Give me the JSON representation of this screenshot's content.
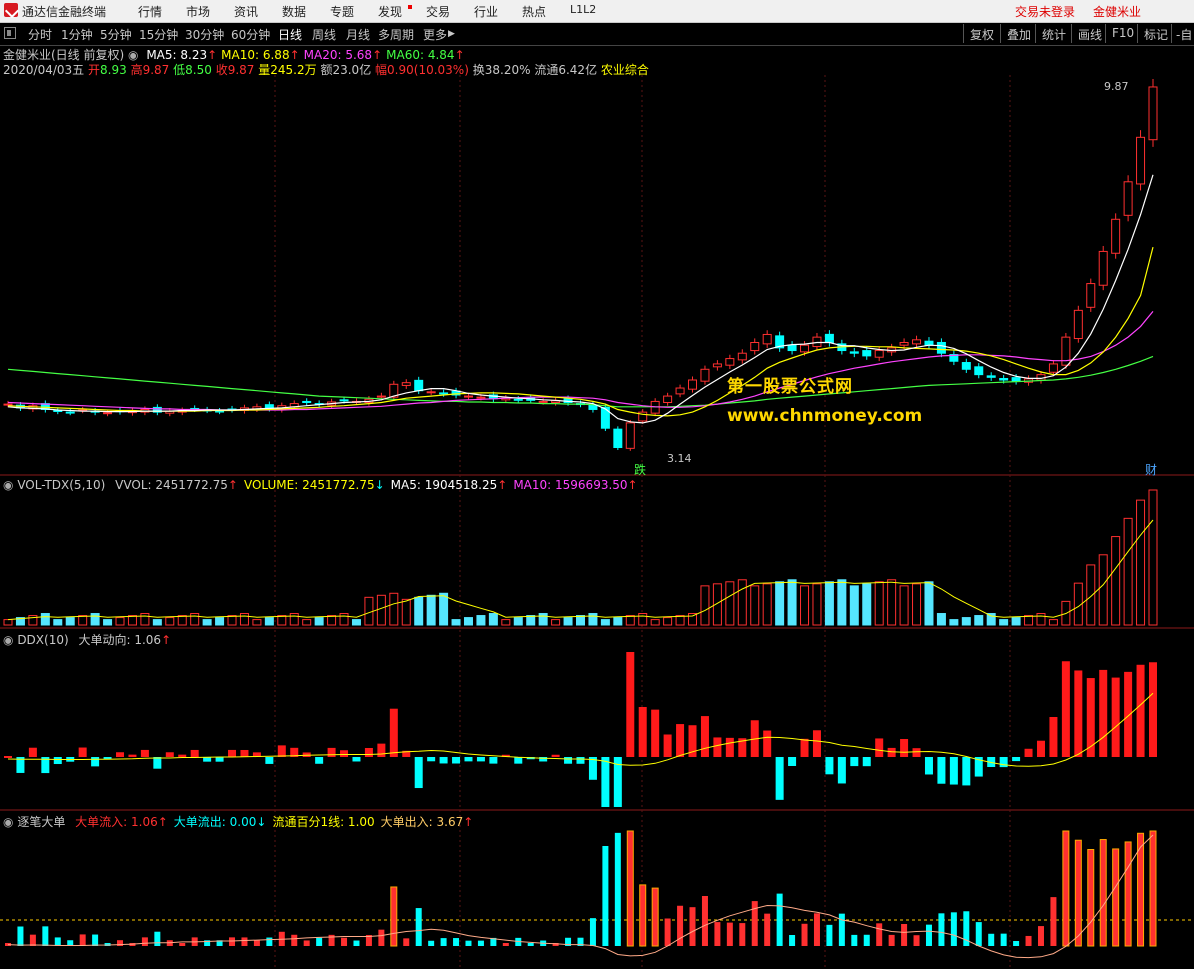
{
  "app": {
    "name": "通达信金融终端"
  },
  "menu": [
    "行情",
    "市场",
    "资讯",
    "数据",
    "专题",
    "发现",
    "交易",
    "行业",
    "热点",
    "L1L2"
  ],
  "menu_right": {
    "status": "交易未登录",
    "stock": "金健米业"
  },
  "periods": [
    "分时",
    "1分钟",
    "5分钟",
    "15分钟",
    "30分钟",
    "60分钟",
    "日线",
    "周线",
    "月线",
    "多周期",
    "更多"
  ],
  "active_period": "日线",
  "toolbar": [
    "复权",
    "叠加",
    "统计",
    "画线",
    "F10",
    "标记",
    "-自"
  ],
  "main_panel": {
    "title": "金健米业(日线 前复权)",
    "ma": [
      {
        "label": "MA5: 8.23",
        "color": "#ffffff"
      },
      {
        "label": "MA10: 6.88",
        "color": "#ffff00"
      },
      {
        "label": "MA20: 5.68",
        "color": "#ff44ff"
      },
      {
        "label": "MA60: 4.84",
        "color": "#44ff44"
      }
    ],
    "quote": {
      "date": "2020/04/03五",
      "open_label": "开",
      "open": "8.93",
      "high_label": "高",
      "high": "9.87",
      "low_label": "低",
      "low": "8.50",
      "close_label": "收",
      "close": "9.87",
      "vol_label": "量",
      "vol": "245.2万",
      "amount_label": "额",
      "amount": "23.0亿",
      "pct_label": "幅",
      "pct": "0.90(10.03%)",
      "turn_label": "换",
      "turn": "38.20%",
      "float_label": "流通",
      "float": "6.42亿",
      "sector": "农业综合"
    },
    "high_mark": "9.87",
    "low_mark": "3.14",
    "mark_die": "跌",
    "mark_cai": "财"
  },
  "watermark": {
    "line1": "第一股票公式网",
    "line2": "www.chnmoney.com"
  },
  "vol_panel": {
    "name": "VOL-TDX(5,10)",
    "items": [
      {
        "label": "VVOL: 2451772.75",
        "color": "#c8c8c8",
        "arrow": "↑",
        "arrow_color": "#ff3030"
      },
      {
        "label": "VOLUME: 2451772.75",
        "color": "#ffff00",
        "arrow": "↓",
        "arrow_color": "#00ffff"
      },
      {
        "label": "MA5: 1904518.25",
        "color": "#ffffff",
        "arrow": "↑",
        "arrow_color": "#ff3030"
      },
      {
        "label": "MA10: 1596693.50",
        "color": "#ff44ff",
        "arrow": "↑",
        "arrow_color": "#ff3030"
      }
    ]
  },
  "ddx_panel": {
    "name": "DDX(10)",
    "items": [
      {
        "label": "大单动向: 1.06",
        "color": "#c8c8c8",
        "arrow": "↑",
        "arrow_color": "#ff3030"
      }
    ]
  },
  "big_panel": {
    "name": "逐笔大单",
    "items": [
      {
        "label": "大单流入: 1.06",
        "color": "#ff3030",
        "arrow": "↑",
        "arrow_color": "#ff3030"
      },
      {
        "label": "大单流出: 0.00",
        "color": "#00ffff",
        "arrow": "↓",
        "arrow_color": "#00ffff"
      },
      {
        "label": "流通百分1线: 1.00",
        "color": "#ffff00",
        "arrow": "",
        "arrow_color": "#ff3030"
      },
      {
        "label": "大单出入: 3.67",
        "color": "#ffcc66",
        "arrow": "↑",
        "arrow_color": "#ff3030"
      }
    ]
  },
  "chart_data": {
    "type": "candlestick",
    "price_range": [
      3.14,
      9.87
    ],
    "candles_note": "daily bars, last bar 2020/04/03 O8.93 H9.87 L8.50 C9.87",
    "closes": [
      3.95,
      3.88,
      3.92,
      3.85,
      3.82,
      3.8,
      3.84,
      3.8,
      3.79,
      3.81,
      3.82,
      3.85,
      3.8,
      3.82,
      3.83,
      3.86,
      3.84,
      3.82,
      3.85,
      3.88,
      3.9,
      3.87,
      3.92,
      3.96,
      3.98,
      3.95,
      3.99,
      4.02,
      4.0,
      4.04,
      4.1,
      4.32,
      4.35,
      4.2,
      4.18,
      4.15,
      4.12,
      4.1,
      4.08,
      4.05,
      4.06,
      4.03,
      4.02,
      4.0,
      4.01,
      3.98,
      3.95,
      3.85,
      3.5,
      3.14,
      3.6,
      3.8,
      4.0,
      4.1,
      4.25,
      4.4,
      4.6,
      4.7,
      4.8,
      4.9,
      5.1,
      5.25,
      5.0,
      4.95,
      5.05,
      5.2,
      5.1,
      4.95,
      4.9,
      4.85,
      4.95,
      5.0,
      5.1,
      5.15,
      5.05,
      4.9,
      4.75,
      4.6,
      4.5,
      4.45,
      4.4,
      4.38,
      4.42,
      4.5,
      4.7,
      5.2,
      5.7,
      6.2,
      6.8,
      7.4,
      8.1,
      8.93,
      9.87
    ],
    "ma5": [
      3.9,
      3.88,
      3.87,
      3.86,
      3.84,
      3.83,
      3.82,
      3.82,
      3.81,
      3.81,
      3.81,
      3.82,
      3.82,
      3.82,
      3.83,
      3.83,
      3.84,
      3.84,
      3.84,
      3.85,
      3.86,
      3.87,
      3.88,
      3.9,
      3.92,
      3.94,
      3.96,
      3.98,
      3.99,
      4.0,
      4.03,
      4.1,
      4.16,
      4.2,
      4.24,
      4.24,
      4.2,
      4.15,
      4.12,
      4.1,
      4.08,
      4.06,
      4.05,
      4.03,
      4.02,
      4.0,
      3.99,
      3.96,
      3.86,
      3.68,
      3.62,
      3.6,
      3.65,
      3.78,
      3.95,
      4.11,
      4.27,
      4.41,
      4.55,
      4.68,
      4.82,
      4.97,
      5.03,
      5.06,
      5.07,
      5.1,
      5.1,
      5.04,
      5.04,
      5.0,
      4.97,
      4.95,
      4.96,
      5.01,
      5.05,
      5.04,
      4.99,
      4.89,
      4.76,
      4.64,
      4.54,
      4.47,
      4.43,
      4.43,
      4.48,
      4.64,
      4.9,
      5.26,
      5.72,
      6.26,
      6.84,
      7.49,
      8.23
    ],
    "ma10": [
      3.92,
      3.91,
      3.9,
      3.89,
      3.88,
      3.87,
      3.86,
      3.85,
      3.84,
      3.83,
      3.83,
      3.82,
      3.82,
      3.82,
      3.82,
      3.82,
      3.83,
      3.83,
      3.83,
      3.84,
      3.84,
      3.85,
      3.86,
      3.87,
      3.88,
      3.89,
      3.91,
      3.92,
      3.94,
      3.96,
      3.98,
      4.02,
      4.06,
      4.08,
      4.1,
      4.12,
      4.14,
      4.15,
      4.16,
      4.16,
      4.15,
      4.14,
      4.12,
      4.1,
      4.08,
      4.06,
      4.04,
      4.0,
      3.95,
      3.85,
      3.8,
      3.76,
      3.74,
      3.73,
      3.75,
      3.8,
      3.9,
      4.02,
      4.16,
      4.3,
      4.45,
      4.62,
      4.73,
      4.81,
      4.89,
      4.96,
      5.0,
      5.02,
      5.03,
      5.03,
      5.02,
      5.02,
      5.0,
      4.99,
      4.98,
      4.97,
      4.96,
      4.94,
      4.9,
      4.85,
      4.78,
      4.7,
      4.62,
      4.55,
      4.5,
      4.5,
      4.58,
      4.72,
      4.92,
      5.2,
      5.55,
      5.98,
      6.88
    ],
    "ma20": [
      3.98,
      3.97,
      3.96,
      3.95,
      3.94,
      3.93,
      3.92,
      3.91,
      3.9,
      3.89,
      3.88,
      3.87,
      3.86,
      3.86,
      3.85,
      3.85,
      3.85,
      3.84,
      3.84,
      3.84,
      3.84,
      3.84,
      3.84,
      3.85,
      3.85,
      3.86,
      3.87,
      3.88,
      3.89,
      3.9,
      3.91,
      3.93,
      3.95,
      3.97,
      3.98,
      4.0,
      4.02,
      4.03,
      4.04,
      4.05,
      4.06,
      4.07,
      4.08,
      4.08,
      4.08,
      4.08,
      4.07,
      4.06,
      4.03,
      3.98,
      3.95,
      3.92,
      3.9,
      3.89,
      3.89,
      3.9,
      3.92,
      3.95,
      3.99,
      4.04,
      4.1,
      4.18,
      4.25,
      4.32,
      4.39,
      4.46,
      4.52,
      4.57,
      4.62,
      4.66,
      4.7,
      4.74,
      4.77,
      4.8,
      4.83,
      4.85,
      4.86,
      4.87,
      4.87,
      4.86,
      4.85,
      4.83,
      4.8,
      4.78,
      4.76,
      4.76,
      4.79,
      4.84,
      4.93,
      5.05,
      5.2,
      5.4,
      5.68
    ],
    "ma60": [
      4.6,
      4.58,
      4.56,
      4.54,
      4.52,
      4.5,
      4.48,
      4.46,
      4.44,
      4.42,
      4.4,
      4.38,
      4.36,
      4.34,
      4.32,
      4.3,
      4.28,
      4.26,
      4.24,
      4.22,
      4.2,
      4.18,
      4.16,
      4.14,
      4.12,
      4.1,
      4.09,
      4.08,
      4.07,
      4.06,
      4.05,
      4.04,
      4.03,
      4.02,
      4.01,
      4.0,
      4.0,
      3.99,
      3.99,
      3.98,
      3.98,
      3.97,
      3.97,
      3.96,
      3.96,
      3.95,
      3.95,
      3.94,
      3.92,
      3.9,
      3.9,
      3.9,
      3.9,
      3.9,
      3.91,
      3.92,
      3.93,
      3.95,
      3.97,
      3.99,
      4.01,
      4.04,
      4.06,
      4.08,
      4.1,
      4.12,
      4.14,
      4.16,
      4.18,
      4.2,
      4.22,
      4.24,
      4.26,
      4.28,
      4.3,
      4.31,
      4.32,
      4.33,
      4.34,
      4.35,
      4.36,
      4.37,
      4.38,
      4.39,
      4.4,
      4.42,
      4.45,
      4.49,
      4.54,
      4.6,
      4.67,
      4.75,
      4.84
    ]
  }
}
